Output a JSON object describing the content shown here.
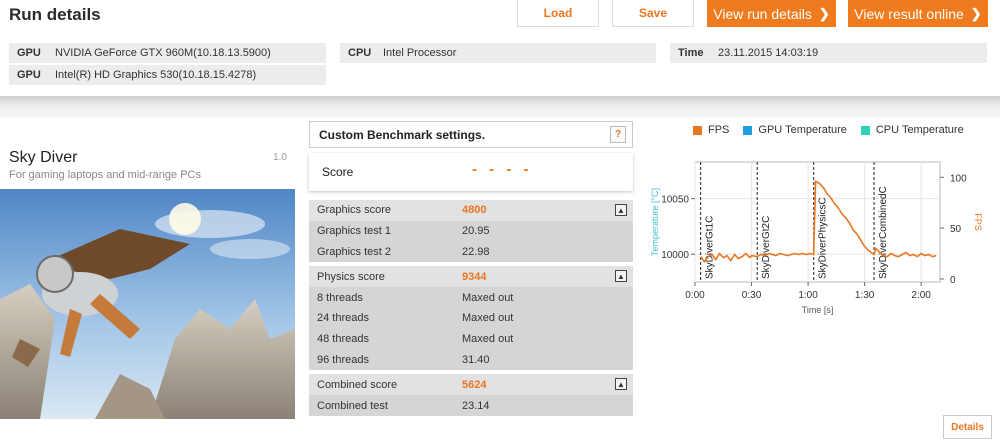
{
  "header": {
    "title": "Run details",
    "load_label": "Load",
    "save_label": "Save",
    "view_run_details_label": "View run details",
    "view_result_online_label": "View result online"
  },
  "system_info": {
    "gpu1": {
      "key": "GPU",
      "value": "NVIDIA GeForce GTX 960M(10.18.13.5900)"
    },
    "gpu2": {
      "key": "GPU",
      "value": "Intel(R) HD Graphics 530(10.18.15.4278)"
    },
    "cpu": {
      "key": "CPU",
      "value": "Intel Processor"
    },
    "time": {
      "key": "Time",
      "value": "23.11.2015 14:03:19"
    }
  },
  "benchmark": {
    "name": "Sky Diver",
    "subtitle": "For gaming laptops and mid-range PCs",
    "version": "1.0"
  },
  "settings": {
    "label": "Custom Benchmark settings.",
    "help": "?",
    "score_label": "Score",
    "score_value": "- - - -"
  },
  "results": {
    "graphics": {
      "label": "Graphics score",
      "value": "4800",
      "tests": [
        {
          "label": "Graphics test 1",
          "value": "20.95"
        },
        {
          "label": "Graphics test 2",
          "value": "22.98"
        }
      ]
    },
    "physics": {
      "label": "Physics score",
      "value": "9344",
      "tests": [
        {
          "label": "8 threads",
          "value": "Maxed out"
        },
        {
          "label": "24 threads",
          "value": "Maxed out"
        },
        {
          "label": "48 threads",
          "value": "Maxed out"
        },
        {
          "label": "96 threads",
          "value": "31.40"
        }
      ]
    },
    "combined": {
      "label": "Combined score",
      "value": "5624",
      "tests": [
        {
          "label": "Combined test",
          "value": "23.14"
        }
      ]
    }
  },
  "chart_legend": {
    "fps": "FPS",
    "gpu_temp": "GPU Temperature",
    "cpu_temp": "CPU Temperature"
  },
  "colors": {
    "accent": "#f07b1e",
    "fps": "#e87722",
    "gpu_temp": "#1e9fe0",
    "cpu_temp": "#2ed3b5",
    "temp_axis": "#3fbfd0"
  },
  "details_label": "Details",
  "chart_data": {
    "type": "line",
    "xlabel": "Time [s]",
    "ylabel_left": "Temperature [°C]",
    "ylabel_right": "FPS",
    "x_ticks": [
      "0:00",
      "0:30",
      "1:00",
      "1:30",
      "2:00"
    ],
    "xlim": [
      0,
      130
    ],
    "y_left_ticks": [
      10000,
      10050
    ],
    "y_left_lim": [
      9975,
      10083
    ],
    "y_right_ticks": [
      0,
      50,
      100
    ],
    "y_right_lim": [
      -3,
      115
    ],
    "grid": true,
    "markers": [
      {
        "label": "SkyDiverGt1C",
        "x": 3
      },
      {
        "label": "SkyDiverGt2C",
        "x": 33
      },
      {
        "label": "SkyDiverPhysicsC",
        "x": 63
      },
      {
        "label": "SkyDiverCombinedC",
        "x": 95
      }
    ],
    "series": [
      {
        "name": "FPS",
        "axis": "right",
        "x": [
          3,
          5,
          7,
          9,
          11,
          13,
          15,
          17,
          19,
          21,
          23,
          25,
          27,
          29,
          30,
          33,
          35,
          37,
          39,
          41,
          43,
          45,
          47,
          49,
          51,
          53,
          55,
          57,
          59,
          61,
          63,
          64,
          66,
          68,
          70,
          72,
          74,
          76,
          78,
          80,
          82,
          84,
          86,
          88,
          90,
          92,
          95,
          96,
          98,
          100,
          102,
          104,
          106,
          108,
          110,
          112,
          114,
          116,
          118,
          120,
          122,
          124,
          126,
          128
        ],
        "y": [
          22,
          17,
          22,
          24,
          19,
          25,
          21,
          23,
          18,
          24,
          20,
          22,
          25,
          21,
          23,
          22,
          24,
          23,
          25,
          24,
          23,
          25,
          24,
          23,
          24,
          25,
          24,
          25,
          24,
          25,
          24,
          96,
          94,
          90,
          84,
          80,
          74,
          70,
          64,
          60,
          55,
          48,
          44,
          38,
          32,
          28,
          24,
          30,
          26,
          23,
          22,
          25,
          23,
          22,
          24,
          26,
          23,
          24,
          22,
          25,
          23,
          24,
          22,
          23
        ]
      }
    ]
  }
}
